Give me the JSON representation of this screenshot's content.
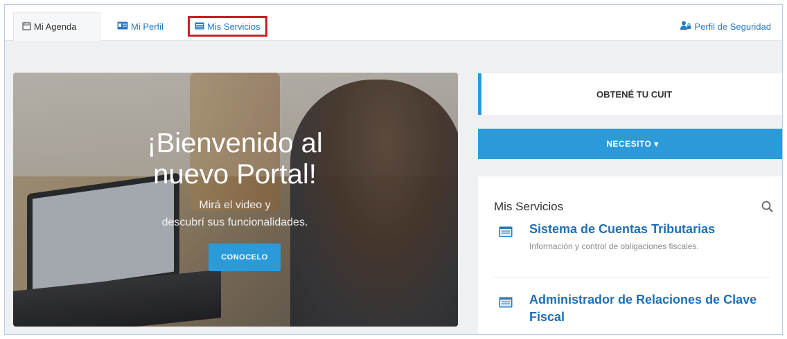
{
  "tabs": {
    "agenda": "Mi Agenda",
    "perfil": "Mi Perfil",
    "servicios": "Mis Servicios",
    "seguridad": "Perfil de Seguridad"
  },
  "hero": {
    "title_line1": "¡Bienvenido al",
    "title_line2": "nuevo Portal!",
    "subtitle_line1": "Mirá el video y",
    "subtitle_line2": "descubrí sus funcionalidades.",
    "button": "CONOCELO"
  },
  "cuit": {
    "label": "OBTENÉ TU CUIT"
  },
  "necesito": {
    "label": "NECESITO ▾"
  },
  "services": {
    "title": "Mis Servicios",
    "items": [
      {
        "name": "Sistema de Cuentas Tributarias",
        "desc": "Información y control de obligaciones fiscales."
      },
      {
        "name": "Administrador de Relaciones de Clave Fiscal",
        "desc": ""
      }
    ]
  },
  "colors": {
    "accent": "#2a9ad8",
    "link": "#1f6fb5",
    "highlight": "#c8202a"
  }
}
